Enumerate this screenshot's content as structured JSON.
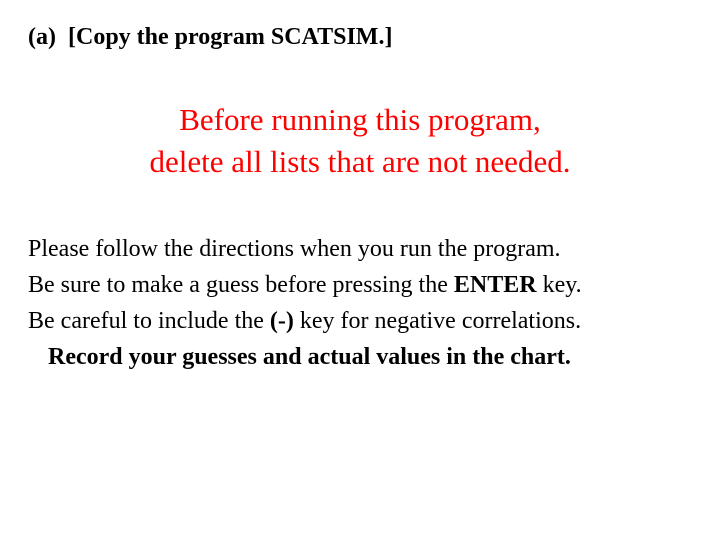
{
  "heading": {
    "label": "(a)",
    "bracket_open": "[",
    "text": "Copy the program SCATSIM.",
    "bracket_close": "]"
  },
  "callout": {
    "line1": "Before running this program,",
    "line2": "delete all lists that are not needed."
  },
  "body": {
    "line1": "Please follow the directions when you run the program.",
    "line2_pre": "Be sure to make a guess before pressing the ",
    "line2_bold": "ENTER",
    "line2_post": " key.",
    "line3_pre": "Be careful to include the ",
    "line3_bold": "(-)",
    "line3_post": " key for negative correlations.",
    "line4": "Record your guesses and actual values in the chart."
  }
}
